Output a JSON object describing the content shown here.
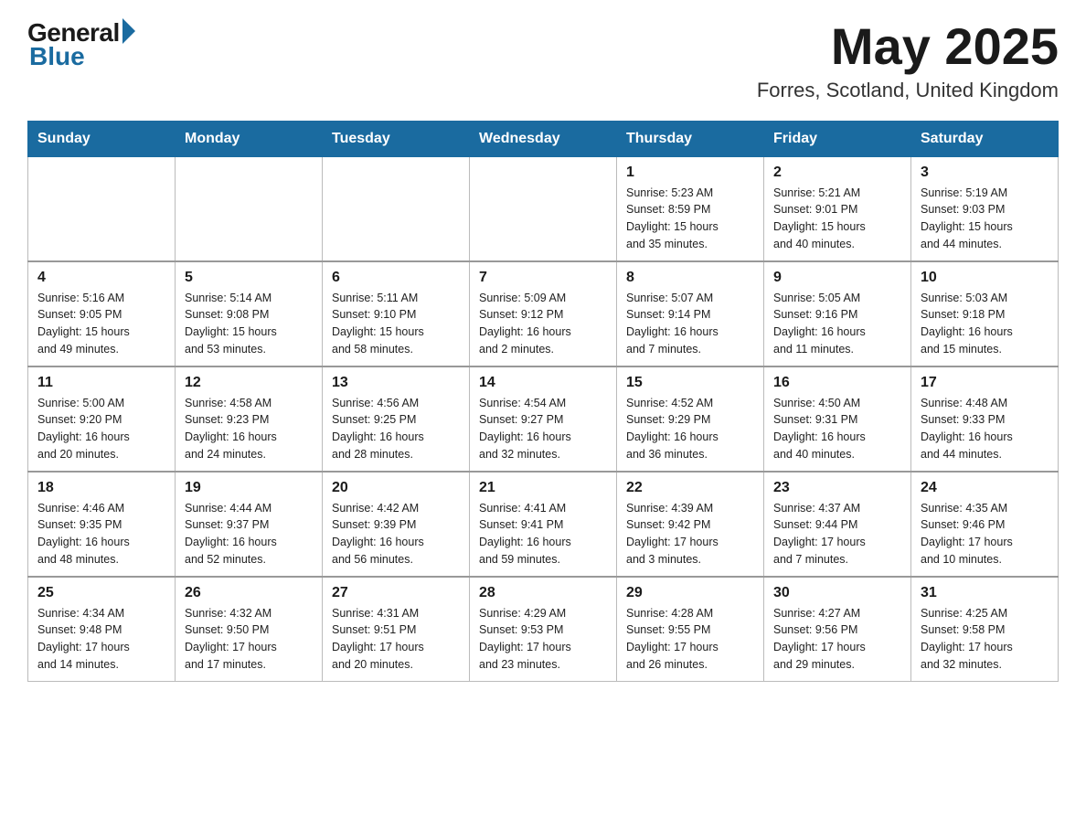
{
  "logo": {
    "general": "General",
    "blue": "Blue"
  },
  "title": "May 2025",
  "location": "Forres, Scotland, United Kingdom",
  "days_header": [
    "Sunday",
    "Monday",
    "Tuesday",
    "Wednesday",
    "Thursday",
    "Friday",
    "Saturday"
  ],
  "weeks": [
    [
      {
        "num": "",
        "info": ""
      },
      {
        "num": "",
        "info": ""
      },
      {
        "num": "",
        "info": ""
      },
      {
        "num": "",
        "info": ""
      },
      {
        "num": "1",
        "info": "Sunrise: 5:23 AM\nSunset: 8:59 PM\nDaylight: 15 hours\nand 35 minutes."
      },
      {
        "num": "2",
        "info": "Sunrise: 5:21 AM\nSunset: 9:01 PM\nDaylight: 15 hours\nand 40 minutes."
      },
      {
        "num": "3",
        "info": "Sunrise: 5:19 AM\nSunset: 9:03 PM\nDaylight: 15 hours\nand 44 minutes."
      }
    ],
    [
      {
        "num": "4",
        "info": "Sunrise: 5:16 AM\nSunset: 9:05 PM\nDaylight: 15 hours\nand 49 minutes."
      },
      {
        "num": "5",
        "info": "Sunrise: 5:14 AM\nSunset: 9:08 PM\nDaylight: 15 hours\nand 53 minutes."
      },
      {
        "num": "6",
        "info": "Sunrise: 5:11 AM\nSunset: 9:10 PM\nDaylight: 15 hours\nand 58 minutes."
      },
      {
        "num": "7",
        "info": "Sunrise: 5:09 AM\nSunset: 9:12 PM\nDaylight: 16 hours\nand 2 minutes."
      },
      {
        "num": "8",
        "info": "Sunrise: 5:07 AM\nSunset: 9:14 PM\nDaylight: 16 hours\nand 7 minutes."
      },
      {
        "num": "9",
        "info": "Sunrise: 5:05 AM\nSunset: 9:16 PM\nDaylight: 16 hours\nand 11 minutes."
      },
      {
        "num": "10",
        "info": "Sunrise: 5:03 AM\nSunset: 9:18 PM\nDaylight: 16 hours\nand 15 minutes."
      }
    ],
    [
      {
        "num": "11",
        "info": "Sunrise: 5:00 AM\nSunset: 9:20 PM\nDaylight: 16 hours\nand 20 minutes."
      },
      {
        "num": "12",
        "info": "Sunrise: 4:58 AM\nSunset: 9:23 PM\nDaylight: 16 hours\nand 24 minutes."
      },
      {
        "num": "13",
        "info": "Sunrise: 4:56 AM\nSunset: 9:25 PM\nDaylight: 16 hours\nand 28 minutes."
      },
      {
        "num": "14",
        "info": "Sunrise: 4:54 AM\nSunset: 9:27 PM\nDaylight: 16 hours\nand 32 minutes."
      },
      {
        "num": "15",
        "info": "Sunrise: 4:52 AM\nSunset: 9:29 PM\nDaylight: 16 hours\nand 36 minutes."
      },
      {
        "num": "16",
        "info": "Sunrise: 4:50 AM\nSunset: 9:31 PM\nDaylight: 16 hours\nand 40 minutes."
      },
      {
        "num": "17",
        "info": "Sunrise: 4:48 AM\nSunset: 9:33 PM\nDaylight: 16 hours\nand 44 minutes."
      }
    ],
    [
      {
        "num": "18",
        "info": "Sunrise: 4:46 AM\nSunset: 9:35 PM\nDaylight: 16 hours\nand 48 minutes."
      },
      {
        "num": "19",
        "info": "Sunrise: 4:44 AM\nSunset: 9:37 PM\nDaylight: 16 hours\nand 52 minutes."
      },
      {
        "num": "20",
        "info": "Sunrise: 4:42 AM\nSunset: 9:39 PM\nDaylight: 16 hours\nand 56 minutes."
      },
      {
        "num": "21",
        "info": "Sunrise: 4:41 AM\nSunset: 9:41 PM\nDaylight: 16 hours\nand 59 minutes."
      },
      {
        "num": "22",
        "info": "Sunrise: 4:39 AM\nSunset: 9:42 PM\nDaylight: 17 hours\nand 3 minutes."
      },
      {
        "num": "23",
        "info": "Sunrise: 4:37 AM\nSunset: 9:44 PM\nDaylight: 17 hours\nand 7 minutes."
      },
      {
        "num": "24",
        "info": "Sunrise: 4:35 AM\nSunset: 9:46 PM\nDaylight: 17 hours\nand 10 minutes."
      }
    ],
    [
      {
        "num": "25",
        "info": "Sunrise: 4:34 AM\nSunset: 9:48 PM\nDaylight: 17 hours\nand 14 minutes."
      },
      {
        "num": "26",
        "info": "Sunrise: 4:32 AM\nSunset: 9:50 PM\nDaylight: 17 hours\nand 17 minutes."
      },
      {
        "num": "27",
        "info": "Sunrise: 4:31 AM\nSunset: 9:51 PM\nDaylight: 17 hours\nand 20 minutes."
      },
      {
        "num": "28",
        "info": "Sunrise: 4:29 AM\nSunset: 9:53 PM\nDaylight: 17 hours\nand 23 minutes."
      },
      {
        "num": "29",
        "info": "Sunrise: 4:28 AM\nSunset: 9:55 PM\nDaylight: 17 hours\nand 26 minutes."
      },
      {
        "num": "30",
        "info": "Sunrise: 4:27 AM\nSunset: 9:56 PM\nDaylight: 17 hours\nand 29 minutes."
      },
      {
        "num": "31",
        "info": "Sunrise: 4:25 AM\nSunset: 9:58 PM\nDaylight: 17 hours\nand 32 minutes."
      }
    ]
  ]
}
